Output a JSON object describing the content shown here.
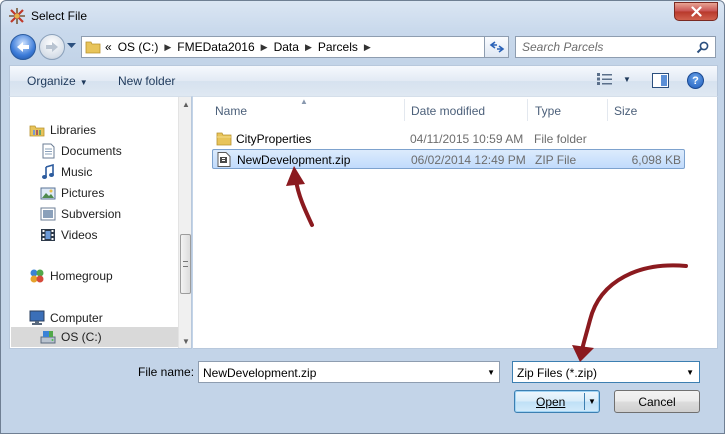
{
  "window": {
    "title": "Select File",
    "title_icon": "fme-workbench-icon"
  },
  "address_bar": {
    "overflow": "«",
    "breadcrumbs": [
      "OS (C:)",
      "FMEData2016",
      "Data",
      "Parcels"
    ],
    "search_placeholder": "Search Parcels"
  },
  "toolbar": {
    "organize_label": "Organize",
    "new_folder_label": "New folder"
  },
  "nav_pane": {
    "libraries": "Libraries",
    "library_items": [
      "Documents",
      "Music",
      "Pictures",
      "Subversion",
      "Videos"
    ],
    "homegroup": "Homegroup",
    "computer": "Computer",
    "drive": "OS (C:)"
  },
  "file_list": {
    "columns": [
      "Name",
      "Date modified",
      "Type",
      "Size"
    ],
    "rows": [
      {
        "name": "CityProperties",
        "date": "04/11/2015 10:59 AM",
        "type": "File folder",
        "size": ""
      },
      {
        "name": "NewDevelopment.zip",
        "date": "06/02/2014 12:49 PM",
        "type": "ZIP File",
        "size": "6,098 KB"
      }
    ]
  },
  "footer": {
    "file_name_label": "File name:",
    "file_name_value": "NewDevelopment.zip",
    "file_type_value": "Zip Files (*.zip)",
    "open_label": "Open",
    "cancel_label": "Cancel"
  },
  "colors": {
    "annotation_arrow": "#8b1a1f",
    "selection": "#c1dbfc"
  }
}
